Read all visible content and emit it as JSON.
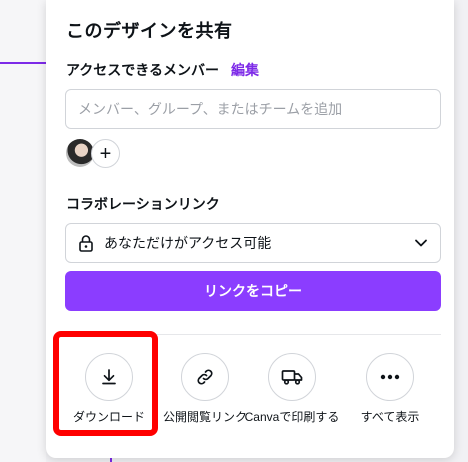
{
  "panel": {
    "title": "このデザインを共有",
    "members_label": "アクセスできるメンバー",
    "edit_link": "編集",
    "search_placeholder": "メンバー、グループ、またはチームを追加",
    "add_button": "+",
    "collab_link_label": "コラボレーションリンク",
    "access_value": "あなただけがアクセス可能",
    "copy_button": "リンクをコピー"
  },
  "actions": [
    {
      "label": "ダウンロード",
      "icon": "download-icon"
    },
    {
      "label": "公開閲覧リンク",
      "icon": "link-icon"
    },
    {
      "label": "Canvaで印刷する",
      "icon": "truck-icon"
    },
    {
      "label": "すべて表示",
      "icon": "more-horizontal-icon"
    }
  ],
  "colors": {
    "accent": "#8b3dff",
    "link": "#7d2ae8",
    "highlight": "#ff0000"
  }
}
